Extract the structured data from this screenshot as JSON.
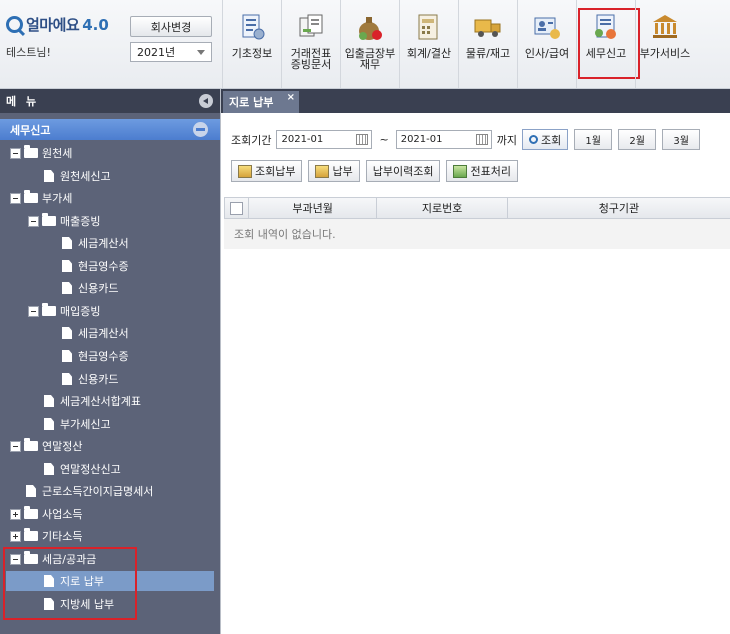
{
  "brand": {
    "name": "얼마에요",
    "version": "4.0"
  },
  "header": {
    "user": "테스트님!",
    "change_company_label": "회사변경",
    "year_value": "2021년"
  },
  "toolbar": [
    {
      "label": "기초정보",
      "icon": "basic-info-icon"
    },
    {
      "label": "거래전표\n증빙문서",
      "icon": "voucher-icon"
    },
    {
      "label": "입출금장부\n재무",
      "icon": "money-bag-icon"
    },
    {
      "label": "회계/결산",
      "icon": "accounting-icon"
    },
    {
      "label": "물류/재고",
      "icon": "truck-icon"
    },
    {
      "label": "인사/급여",
      "icon": "hr-icon"
    },
    {
      "label": "세무신고",
      "icon": "tax-report-icon",
      "active": true
    },
    {
      "label": "부가서비스",
      "icon": "bank-icon"
    }
  ],
  "sidebar": {
    "title": "메 뉴",
    "section": "세무신고",
    "tree": [
      {
        "label": "원천세",
        "type": "folder",
        "pm": "minus",
        "level": 0
      },
      {
        "label": "원천세신고",
        "type": "doc",
        "level": 1
      },
      {
        "label": "부가세",
        "type": "folder",
        "pm": "minus",
        "level": 0
      },
      {
        "label": "매출증빙",
        "type": "folder",
        "pm": "minus",
        "level": 1
      },
      {
        "label": "세금계산서",
        "type": "doc",
        "level": 2
      },
      {
        "label": "현금영수증",
        "type": "doc",
        "level": 2
      },
      {
        "label": "신용카드",
        "type": "doc",
        "level": 2
      },
      {
        "label": "매입증빙",
        "type": "folder",
        "pm": "minus",
        "level": 1
      },
      {
        "label": "세금계산서",
        "type": "doc",
        "level": 2
      },
      {
        "label": "현금영수증",
        "type": "doc",
        "level": 2
      },
      {
        "label": "신용카드",
        "type": "doc",
        "level": 2
      },
      {
        "label": "세금계산서합계표",
        "type": "doc",
        "level": 1
      },
      {
        "label": "부가세신고",
        "type": "doc",
        "level": 1
      },
      {
        "label": "연말정산",
        "type": "folder",
        "pm": "minus",
        "level": 0
      },
      {
        "label": "연말정산신고",
        "type": "doc",
        "level": 1
      },
      {
        "label": "근로소득간이지급명세서",
        "type": "doc",
        "level": 0
      },
      {
        "label": "사업소득",
        "type": "folder",
        "pm": "plus",
        "level": 0
      },
      {
        "label": "기타소득",
        "type": "folder",
        "pm": "plus",
        "level": 0
      },
      {
        "label": "세금/공과금",
        "type": "folder",
        "pm": "minus",
        "level": 0
      },
      {
        "label": "지로 납부",
        "type": "doc",
        "level": 1,
        "selected": true
      },
      {
        "label": "지방세 납부",
        "type": "doc",
        "level": 1
      }
    ]
  },
  "tab": {
    "label": "지로 납부",
    "close": "×"
  },
  "filter": {
    "label": "조회기간",
    "from": "2021-01",
    "tilde": "~",
    "to": "2021-01",
    "until": "까지",
    "search_label": "조회",
    "months": [
      "1월",
      "2월",
      "3월"
    ]
  },
  "actions": [
    "조회납부",
    "납부",
    "납부이력조회",
    "전표처리"
  ],
  "grid": {
    "columns": [
      "부과년월",
      "지로번호",
      "청구기관"
    ],
    "empty_message": "조회 내역이 없습니다."
  },
  "colors": {
    "accent_red": "#d9222a",
    "sidebar_bg": "#5c6378",
    "section_blue": "#4c7dcf"
  }
}
